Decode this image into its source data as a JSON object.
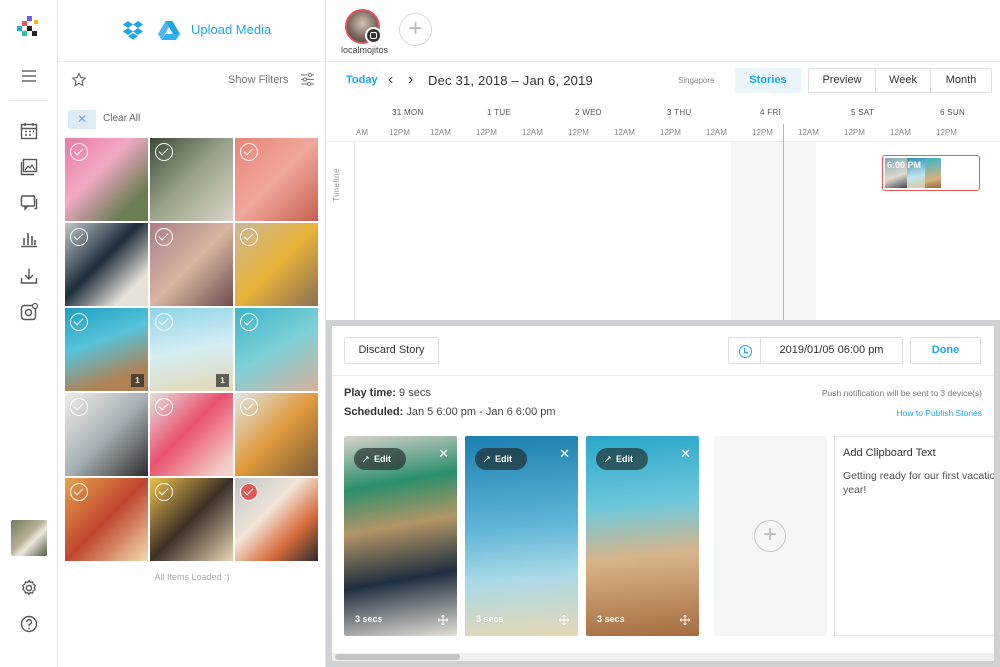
{
  "media": {
    "upload_label": "Upload Media",
    "show_filters": "Show Filters",
    "clear_all": "Clear All",
    "all_loaded": "All Items Loaded :)",
    "thumbs": [
      {
        "badge": ""
      },
      {
        "badge": ""
      },
      {
        "badge": ""
      },
      {
        "badge": ""
      },
      {
        "badge": ""
      },
      {
        "badge": ""
      },
      {
        "badge": "1"
      },
      {
        "badge": "1"
      },
      {
        "badge": ""
      },
      {
        "badge": ""
      },
      {
        "badge": ""
      },
      {
        "badge": ""
      },
      {
        "badge": ""
      },
      {
        "badge": ""
      },
      {
        "badge": ""
      }
    ]
  },
  "account": {
    "name": "localmojitos"
  },
  "toolbar": {
    "today": "Today",
    "prev": "‹",
    "next": "›",
    "date_range": "Dec 31, 2018 – Jan 6, 2019",
    "timezone": "Singapore",
    "stories": "Stories",
    "preview": "Preview",
    "week": "Week",
    "month": "Month"
  },
  "days": [
    "31 MON",
    "1 TUE",
    "2 WED",
    "3 THU",
    "4 FRI",
    "5 SAT",
    "6 SUN"
  ],
  "hours": [
    "AM",
    "12PM",
    "12AM",
    "12PM",
    "12AM",
    "12PM",
    "12AM",
    "12PM",
    "12AM",
    "12PM",
    "12AM",
    "12PM",
    "12AM",
    "12PM"
  ],
  "timeline_label": "Timeline",
  "event": {
    "time": "6:00 PM"
  },
  "editor": {
    "discard": "Discard Story",
    "datetime": "2019/01/05 06:00 pm",
    "done": "Done",
    "play_time_label": "Play time:",
    "play_time": "9 secs",
    "scheduled_label": "Scheduled:",
    "scheduled": "Jan 5 6:00 pm - Jan 6 6:00 pm",
    "push_note": "Push notification will be sent to 3 device(s)",
    "howto": "How to Publish Stories",
    "stories": [
      {
        "edit": "Edit",
        "secs": "3 secs"
      },
      {
        "edit": "Edit",
        "secs": "3 secs"
      },
      {
        "edit": "Edit",
        "secs": "3 secs"
      }
    ],
    "clipboard_title": "Add Clipboard Text",
    "clipboard_text": "Getting ready for our first vacation of the year!"
  },
  "colors": {
    "accent": "#1da7e8",
    "event_border": "#e55a55"
  }
}
